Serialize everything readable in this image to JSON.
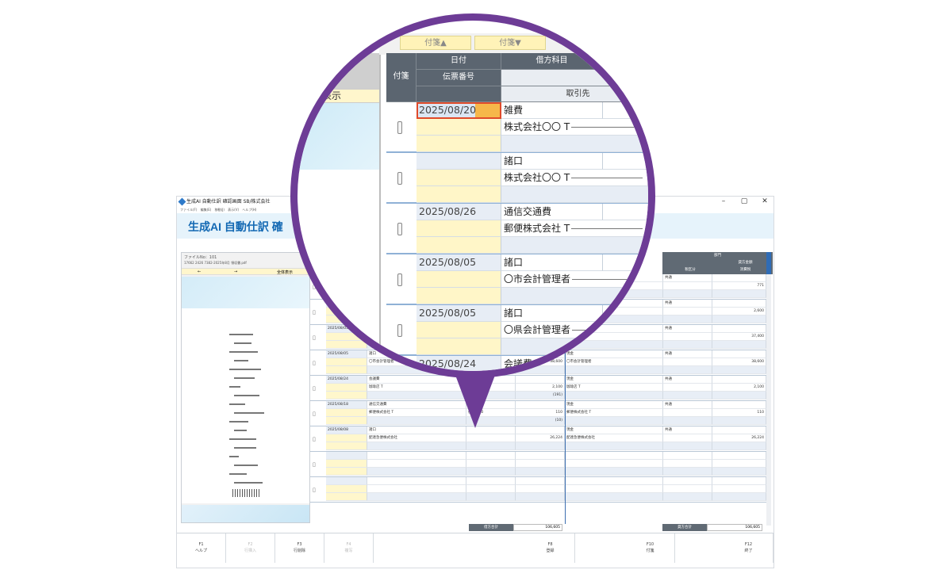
{
  "window": {
    "title": "生成AI 自動仕訳 確認画面 SB/株式会社",
    "menu": "ファイル(F)  編集(E)  移動(J)  表示(V)  ヘルプ(H)",
    "controls": [
      "–",
      "▢",
      "✕"
    ],
    "banner_title": "生成AI 自動仕訳 確"
  },
  "preview": {
    "file_no": "ファイルNo：101",
    "file_name": "17662 2426 7382-2025年8月 領収書.pdf",
    "nav_prev": "←",
    "nav_next": "→",
    "nav_full": "全体表示"
  },
  "magnifier": {
    "left_show_label": "表示",
    "tag_up": "付箋▲",
    "tag_down": "付箋▼",
    "headers": {
      "tag": "付箋",
      "date": "日付",
      "slip_no": "伝票番号",
      "debit_account": "借方科目",
      "partner": "取引先"
    },
    "rows": [
      {
        "date": "2025/08/20",
        "account": "雑費",
        "partner": "株式会社〇〇 T"
      },
      {
        "date": "",
        "account": "諸口",
        "partner": "株式会社〇〇 T"
      },
      {
        "date": "2025/08/26",
        "account": "通信交通費",
        "partner": "郵便株式会社 T"
      },
      {
        "date": "2025/08/05",
        "account": "諸口",
        "partner": "〇市会計管理者"
      },
      {
        "date": "2025/08/05",
        "account": "諸口",
        "partner": "〇県会計管理者"
      },
      {
        "date": "2025/08/24",
        "account": "会議費",
        "partner": "珈琲店 T"
      }
    ]
  },
  "grid": {
    "header_right": {
      "dept": "部門",
      "tax": "税区分",
      "credit_amount": "貸方金額",
      "tax_amount": "消費税"
    },
    "rows": [
      {
        "date": "",
        "account": "",
        "partner": "",
        "amount": "",
        "cr_account": "",
        "cr_partner": "",
        "tax": "共通",
        "cr_amount": "771"
      },
      {
        "date": "",
        "account": "",
        "partner": "",
        "amount": "",
        "cr_account": "",
        "cr_partner": "",
        "tax": "共通",
        "cr_amount": "2,600"
      },
      {
        "date": "2025/08/05",
        "account": "",
        "partner": "",
        "amount": "",
        "cr_account": "",
        "cr_partner": "理者",
        "tax": "共通",
        "cr_amount": "37,400"
      },
      {
        "date": "2025/08/05",
        "account": "諸口",
        "partner": "〇市会計管理者",
        "amount": "38,600",
        "cr_account": "現金",
        "cr_partner": "〇市会計管理者",
        "tax": "共通",
        "cr_amount": "38,600"
      },
      {
        "date": "2025/08/24",
        "account": "会議費",
        "partner": "珈琲店 T",
        "amount": "2,100",
        "sub_amount": "(191)",
        "cr_account": "現金",
        "cr_partner": "珈琲店 T",
        "tax": "共通",
        "cr_amount": "2,100"
      },
      {
        "date": "2025/08/18",
        "account": "通信交通費",
        "partner": "郵便株式会社 T",
        "dept": "往復内10",
        "amount": "110",
        "sub_amount": "(10)",
        "cr_account": "現金",
        "cr_partner": "郵便株式会社 T",
        "tax": "共通",
        "cr_amount": "110"
      },
      {
        "date": "2025/08/08",
        "account": "諸口",
        "partner": "配達急便株式会社",
        "amount": "26,224",
        "cr_account": "現金",
        "cr_partner": "配達急便株式会社",
        "tax": "共通",
        "cr_amount": "26,224"
      },
      {
        "date": "",
        "account": "",
        "partner": "",
        "amount": "",
        "cr_account": "",
        "cr_partner": "",
        "tax": "",
        "cr_amount": ""
      },
      {
        "date": "",
        "account": "",
        "partner": "",
        "amount": "",
        "cr_account": "",
        "cr_partner": "",
        "tax": "",
        "cr_amount": ""
      }
    ],
    "totals": {
      "debit_label": "借方合計",
      "debit_value": "106,605",
      "credit_label": "貸方合計",
      "credit_value": "106,605"
    }
  },
  "fkeys": [
    {
      "key": "F1",
      "label": "ヘルプ",
      "enabled": true
    },
    {
      "key": "F2",
      "label": "行挿入",
      "enabled": false
    },
    {
      "key": "F3",
      "label": "行削除",
      "enabled": true
    },
    {
      "key": "F4",
      "label": "複写",
      "enabled": false
    },
    {
      "key": "F8",
      "label": "登録",
      "enabled": true
    },
    {
      "key": "F10",
      "label": "付箋",
      "enabled": true
    },
    {
      "key": "F12",
      "label": "終了",
      "enabled": true
    }
  ],
  "colors": {
    "lens_border": "#6d3c96",
    "header_dark": "#5b6570",
    "title_blue": "#1268b3",
    "cell_yellow": "#fff6c8"
  }
}
